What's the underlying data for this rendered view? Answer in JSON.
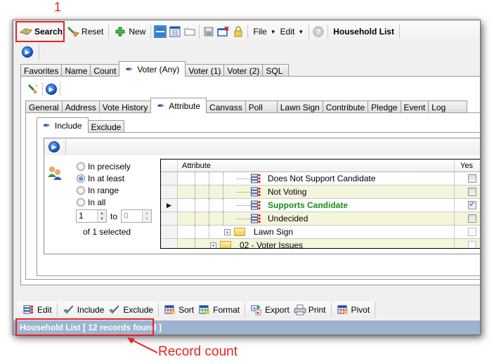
{
  "annotations": {
    "step_number": "1",
    "record_count_label": "Record count"
  },
  "toolbar": {
    "search_label": "Search",
    "reset_label": "Reset",
    "new_label": "New",
    "file_label": "File",
    "edit_label": "Edit",
    "title": "Household List"
  },
  "main_tabs": [
    {
      "label": "Favorites"
    },
    {
      "label": "Name"
    },
    {
      "label": "Count"
    },
    {
      "label": "Voter (Any)",
      "active": true
    },
    {
      "label": "Voter (1)"
    },
    {
      "label": "Voter (2)"
    },
    {
      "label": "SQL"
    }
  ],
  "sub_tabs": [
    {
      "label": "General"
    },
    {
      "label": "Address"
    },
    {
      "label": "Vote History"
    },
    {
      "label": "Attribute",
      "active": true
    },
    {
      "label": "Canvass"
    },
    {
      "label": "Poll"
    },
    {
      "label": "Lawn Sign"
    },
    {
      "label": "Contribute"
    },
    {
      "label": "Pledge"
    },
    {
      "label": "Event"
    },
    {
      "label": "Log"
    }
  ],
  "include_tabs": [
    {
      "label": "Include",
      "active": true
    },
    {
      "label": "Exclude"
    }
  ],
  "match_options": [
    {
      "label": "In precisely",
      "selected": false
    },
    {
      "label": "In at least",
      "selected": true
    },
    {
      "label": "In range",
      "selected": false
    },
    {
      "label": "In all",
      "selected": false
    }
  ],
  "range": {
    "from_value": "1",
    "to_label": "to",
    "to_value": "0",
    "selected_summary": "of 1 selected"
  },
  "grid": {
    "columns": [
      "Attribute",
      "Yes"
    ],
    "rows": [
      {
        "label": "Does Not Support Candidate",
        "checked": false,
        "level": 3,
        "type": "item"
      },
      {
        "label": "Not Voting",
        "checked": false,
        "level": 3,
        "type": "item"
      },
      {
        "label": "Supports Candidate",
        "checked": true,
        "level": 3,
        "type": "item",
        "current": true,
        "highlight": true
      },
      {
        "label": "Undecided",
        "checked": false,
        "level": 3,
        "type": "item"
      },
      {
        "label": "Lawn Sign",
        "checked": false,
        "level": 2,
        "type": "folder"
      },
      {
        "label": "02 - Voter Issues",
        "checked": false,
        "level": 1,
        "type": "folder"
      }
    ]
  },
  "bottom_toolbar": {
    "edit_label": "Edit",
    "include_label": "Include",
    "exclude_label": "Exclude",
    "sort_label": "Sort",
    "format_label": "Format",
    "export_label": "Export",
    "print_label": "Print",
    "pivot_label": "Pivot"
  },
  "status": {
    "text": "Household List [ 12 records found ]"
  },
  "colors": {
    "annotation_red": "#e8231f",
    "status_bar_bg": "#9db4d1",
    "selected_green": "#1a8a1a",
    "alt_row_bg": "#f5f5dc"
  }
}
